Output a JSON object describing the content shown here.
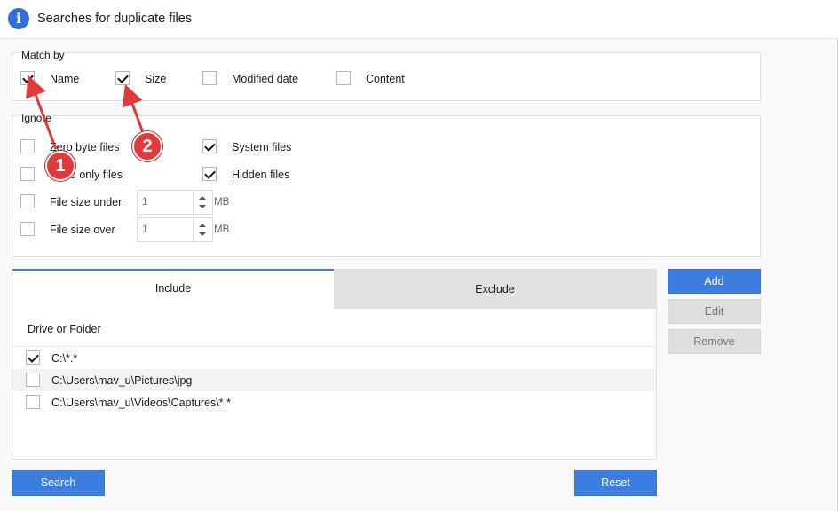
{
  "header": {
    "title": "Searches for duplicate files",
    "icon": "info-icon"
  },
  "match_by": {
    "label": "Match by",
    "options": [
      {
        "label": "Name",
        "checked": true
      },
      {
        "label": "Size",
        "checked": true
      },
      {
        "label": "Modified date",
        "checked": false
      },
      {
        "label": "Content",
        "checked": false
      }
    ]
  },
  "ignore": {
    "label": "Ignore",
    "zero_byte": {
      "label": "Zero byte files",
      "checked": false
    },
    "read_only": {
      "label": "Read only files",
      "checked": false
    },
    "system": {
      "label": "System files",
      "checked": true
    },
    "hidden": {
      "label": "Hidden files",
      "checked": true
    },
    "size_under": {
      "label": "File size under",
      "checked": false,
      "value": "1",
      "unit": "MB"
    },
    "size_over": {
      "label": "File size over",
      "checked": false,
      "value": "1",
      "unit": "MB"
    }
  },
  "tabs": {
    "include": "Include",
    "exclude": "Exclude",
    "active": "include"
  },
  "list": {
    "header": "Drive or Folder",
    "rows": [
      {
        "path": "C:\\*.*",
        "checked": true
      },
      {
        "path": "C:\\Users\\mav_u\\Pictures\\jpg",
        "checked": false
      },
      {
        "path": "C:\\Users\\mav_u\\Videos\\Captures\\*.*",
        "checked": false
      }
    ]
  },
  "side_buttons": {
    "add": "Add",
    "edit": "Edit",
    "remove": "Remove"
  },
  "footer": {
    "search": "Search",
    "reset": "Reset"
  },
  "annotations": {
    "badge1": "1",
    "badge2": "2",
    "color": "#e03a3a"
  },
  "colors": {
    "accent": "#3c7ee0",
    "annotation": "#e03a3a"
  }
}
